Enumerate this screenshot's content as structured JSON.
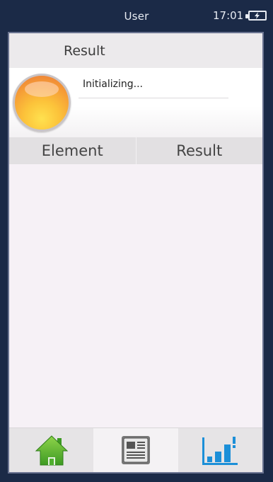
{
  "statusbar": {
    "user": "User",
    "time": "17:01"
  },
  "result_header": {
    "title": "Result"
  },
  "status_panel": {
    "text": "Initializing..."
  },
  "table": {
    "columns": [
      "Element",
      "Result"
    ],
    "rows": []
  },
  "bottom_nav": [
    {
      "icon": "home-icon"
    },
    {
      "icon": "report-icon"
    },
    {
      "icon": "bar-chart-icon"
    }
  ],
  "colors": {
    "background": "#1b2a47",
    "panel": "#f6f1f6",
    "home_green": "#4fae2e",
    "chart_blue": "#1c8fd8"
  }
}
